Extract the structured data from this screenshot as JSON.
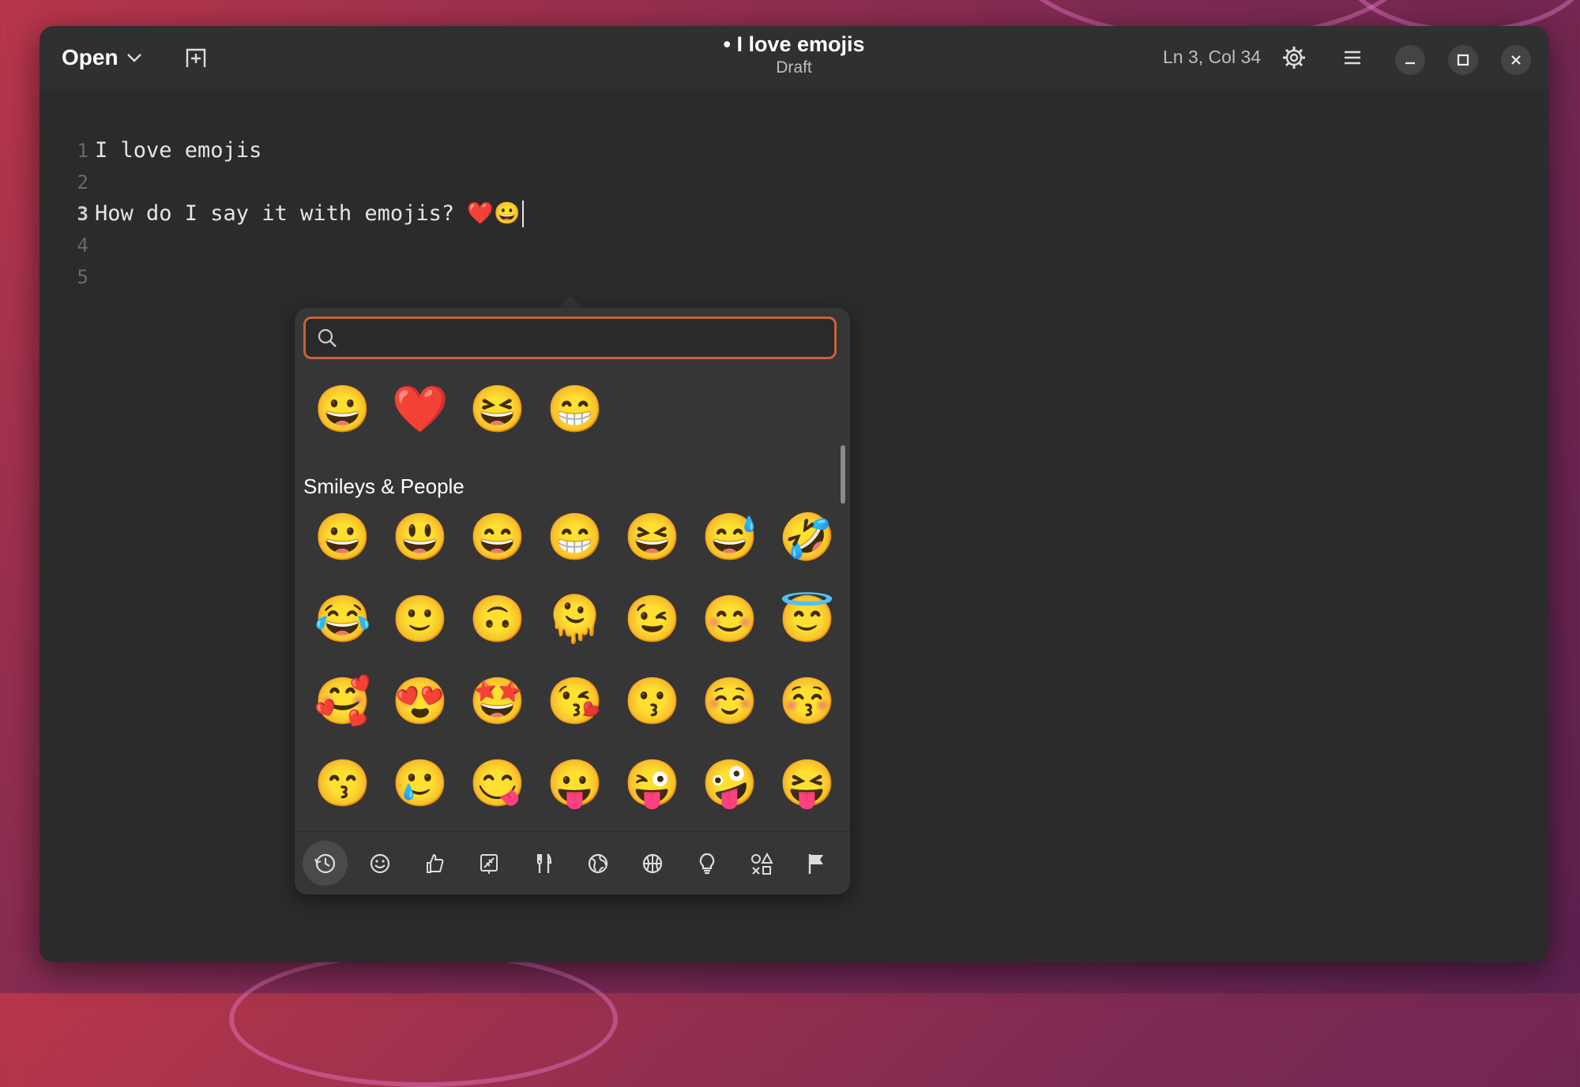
{
  "window": {
    "title": "• I love emojis",
    "subtitle": "Draft",
    "open_label": "Open",
    "cursor_position": "Ln 3, Col 34"
  },
  "editor": {
    "line_numbers": [
      "1",
      "2",
      "3",
      "4",
      "5"
    ],
    "current_line": 3,
    "lines": [
      "I love emojis",
      "",
      "How do I say it with emojis? ❤️😀",
      "",
      ""
    ]
  },
  "emoji_picker": {
    "search_value": "",
    "recent": [
      "😀",
      "❤️",
      "😆",
      "😁"
    ],
    "section_title": "Smileys & People",
    "rows": [
      [
        "😀",
        "😃",
        "😄",
        "😁",
        "😆",
        "😅",
        "🤣"
      ],
      [
        "😂",
        "🙂",
        "🙃",
        "🫠",
        "😉",
        "😊",
        "😇"
      ],
      [
        "🥰",
        "😍",
        "🤩",
        "😘",
        "😗",
        "☺️",
        "😚"
      ],
      [
        "😙",
        "🥲",
        "😋",
        "😛",
        "😜",
        "🤪",
        "😝"
      ]
    ],
    "categories": [
      {
        "name": "recent-icon",
        "active": true
      },
      {
        "name": "smileys-icon",
        "active": false
      },
      {
        "name": "body-icon",
        "active": false
      },
      {
        "name": "nature-icon",
        "active": false
      },
      {
        "name": "food-icon",
        "active": false
      },
      {
        "name": "travel-icon",
        "active": false
      },
      {
        "name": "activities-icon",
        "active": false
      },
      {
        "name": "objects-icon",
        "active": false
      },
      {
        "name": "symbols-icon",
        "active": false
      },
      {
        "name": "flags-icon",
        "active": false
      }
    ]
  },
  "colors": {
    "accent": "#c8623a",
    "window_bg": "#2b2b2b",
    "header_bg": "#303030",
    "popover_bg": "#363636"
  }
}
